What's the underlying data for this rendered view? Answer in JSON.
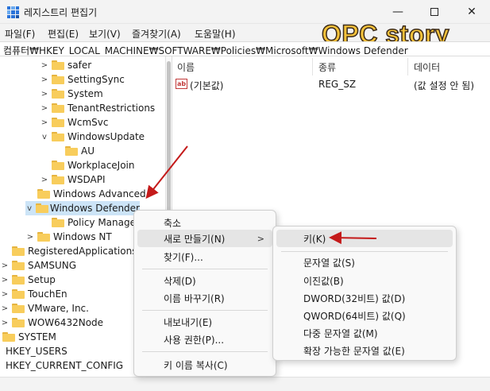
{
  "window": {
    "title": "레지스트리 편집기",
    "minimize_glyph": "—",
    "close_glyph": "✕"
  },
  "menu": [
    "파일(F)",
    "편집(E)",
    "보기(V)",
    "즐겨찾기(A)",
    "도움말(H)"
  ],
  "watermark": "OPC story",
  "address": "컴퓨터₩HKEY_LOCAL_MACHINE₩SOFTWARE₩Policies₩Microsoft₩Windows Defender",
  "tree": [
    {
      "label": "safer",
      "chevron": ">",
      "folder": true,
      "selected": false
    },
    {
      "label": "SettingSync",
      "chevron": ">",
      "folder": true,
      "selected": false
    },
    {
      "label": "System",
      "chevron": ">",
      "folder": true,
      "selected": false
    },
    {
      "label": "TenantRestrictions",
      "chevron": ">",
      "folder": true,
      "selected": false
    },
    {
      "label": "WcmSvc",
      "chevron": ">",
      "folder": true,
      "selected": false
    },
    {
      "label": "WindowsUpdate",
      "chevron": "v",
      "folder": true,
      "selected": false
    },
    {
      "label": "AU",
      "chevron": "",
      "folder": true,
      "selected": false
    },
    {
      "label": "WorkplaceJoin",
      "chevron": "",
      "folder": true,
      "selected": false
    },
    {
      "label": "WSDAPI",
      "chevron": ">",
      "folder": true,
      "selected": false
    },
    {
      "label": "Windows Advanced",
      "chevron": "",
      "folder": true,
      "selected": false
    },
    {
      "label": "Windows Defender",
      "chevron": "v",
      "folder": true,
      "selected": true
    },
    {
      "label": "Policy Manage",
      "chevron": "",
      "folder": true,
      "selected": false
    },
    {
      "label": "Windows NT",
      "chevron": ">",
      "folder": true,
      "selected": false
    },
    {
      "label": "RegisteredApplications",
      "chevron": "",
      "folder": true,
      "selected": false
    },
    {
      "label": "SAMSUNG",
      "chevron": ">",
      "folder": true,
      "selected": false
    },
    {
      "label": "Setup",
      "chevron": ">",
      "folder": true,
      "selected": false
    },
    {
      "label": "TouchEn",
      "chevron": ">",
      "folder": true,
      "selected": false
    },
    {
      "label": "VMware, Inc.",
      "chevron": ">",
      "folder": true,
      "selected": false
    },
    {
      "label": "WOW6432Node",
      "chevron": ">",
      "folder": true,
      "selected": false
    },
    {
      "label": "SYSTEM",
      "chevron": ">",
      "folder": true,
      "selected": false
    },
    {
      "label": "HKEY_USERS",
      "chevron": ">",
      "folder": false,
      "selected": false
    },
    {
      "label": "HKEY_CURRENT_CONFIG",
      "chevron": ">",
      "folder": false,
      "selected": false
    }
  ],
  "list": {
    "columns": [
      "이름",
      "종류",
      "데이터"
    ],
    "rows": [
      {
        "icon_text": "ab",
        "name": "(기본값)",
        "type": "REG_SZ",
        "data": "(값 설정 안 됨)"
      }
    ]
  },
  "context_menu": {
    "items": [
      "축소",
      "새로 만들기(N)",
      "찾기(F)...",
      "삭제(D)",
      "이름 바꾸기(R)",
      "내보내기(E)",
      "사용 권한(P)...",
      "키 이름 복사(C)"
    ],
    "submenu_arrow": ">"
  },
  "submenu": {
    "items": [
      "키(K)",
      "문자열 값(S)",
      "이진값(B)",
      "DWORD(32비트) 값(D)",
      "QWORD(64비트) 값(Q)",
      "다중 문자열 값(M)",
      "확장 가능한 문자열 값(E)"
    ]
  },
  "colors": {
    "selected_row": "#cce4f7",
    "annotation_arrow": "#c41a1a",
    "watermark_fill": "#f5c23a"
  }
}
